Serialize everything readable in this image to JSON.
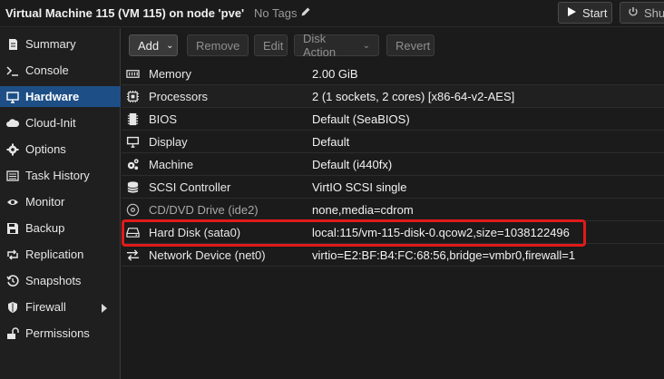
{
  "titlebar": {
    "title": "Virtual Machine 115 (VM 115) on node 'pve'",
    "tags_label": "No Tags",
    "start_label": "Start",
    "shutdown_label": "Shut"
  },
  "sidebar": {
    "items": [
      {
        "label": "Summary",
        "icon": "summary-icon"
      },
      {
        "label": "Console",
        "icon": "console-icon"
      },
      {
        "label": "Hardware",
        "icon": "monitor-icon",
        "active": true
      },
      {
        "label": "Cloud-Init",
        "icon": "cloud-icon"
      },
      {
        "label": "Options",
        "icon": "gear-icon"
      },
      {
        "label": "Task History",
        "icon": "list-icon"
      },
      {
        "label": "Monitor",
        "icon": "eye-icon"
      },
      {
        "label": "Backup",
        "icon": "floppy-icon"
      },
      {
        "label": "Replication",
        "icon": "retweet-icon"
      },
      {
        "label": "Snapshots",
        "icon": "history-icon"
      },
      {
        "label": "Firewall",
        "icon": "shield-icon"
      },
      {
        "label": "Permissions",
        "icon": "unlock-icon"
      }
    ]
  },
  "toolbar": {
    "add_label": "Add",
    "remove_label": "Remove",
    "edit_label": "Edit",
    "disk_action_label": "Disk Action",
    "revert_label": "Revert"
  },
  "hardware": {
    "rows": [
      {
        "key": "Memory",
        "value": "2.00 GiB",
        "icon": "memory-icon"
      },
      {
        "key": "Processors",
        "value": "2 (1 sockets, 2 cores) [x86-64-v2-AES]",
        "icon": "cpu-icon"
      },
      {
        "key": "BIOS",
        "value": "Default (SeaBIOS)",
        "icon": "microchip-icon"
      },
      {
        "key": "Display",
        "value": "Default",
        "icon": "desktop-icon"
      },
      {
        "key": "Machine",
        "value": "Default (i440fx)",
        "icon": "cogs-icon"
      },
      {
        "key": "SCSI Controller",
        "value": "VirtIO SCSI single",
        "icon": "database-icon"
      },
      {
        "key": "CD/DVD Drive (ide2)",
        "value": "none,media=cdrom",
        "icon": "cdrom-icon"
      },
      {
        "key": "Hard Disk (sata0)",
        "value": "local:115/vm-115-disk-0.qcow2,size=1038122496",
        "icon": "hdd-icon"
      },
      {
        "key": "Network Device (net0)",
        "value": "virtio=E2:BF:B4:FC:68:56,bridge=vmbr0,firewall=1",
        "icon": "exchange-icon"
      }
    ]
  },
  "colors": {
    "active_nav": "#1d4f86",
    "highlight_box": "#e11a1a"
  }
}
